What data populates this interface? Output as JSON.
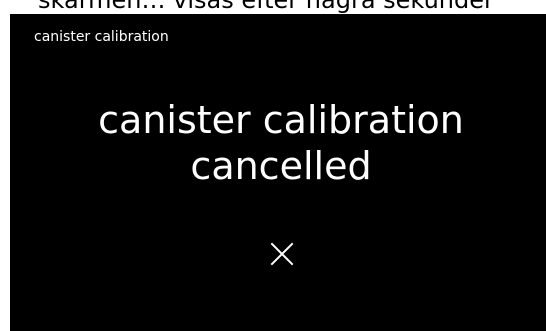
{
  "top_strip": {
    "text": "skärmen… visas efter nagra sekunder"
  },
  "screen": {
    "title": "canister calibration",
    "message_line1": "canister calibration",
    "message_line2": "cancelled",
    "close_icon": "close-icon"
  },
  "colors": {
    "background": "#000000",
    "text": "#ffffff"
  }
}
